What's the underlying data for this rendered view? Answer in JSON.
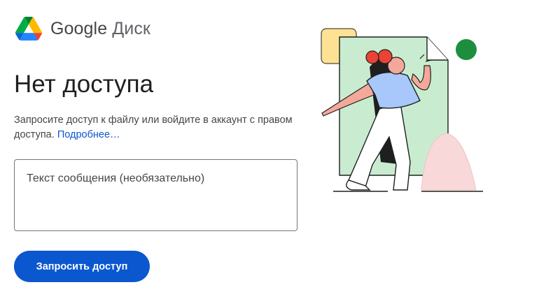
{
  "header": {
    "logo_icon": "google-drive-icon",
    "brand_google": "Google",
    "brand_product": "Диск"
  },
  "main": {
    "title": "Нет доступа",
    "description": "Запросите доступ к файлу или войдите в аккаунт с правом доступа.",
    "learn_more_link": "Подробнее…",
    "message_placeholder": "Текст сообщения (необязательно)",
    "request_button": "Запросить доступ"
  },
  "illustration": {
    "icon": "person-leaving-document-illustration"
  },
  "colors": {
    "accent_blue": "#0b57d0",
    "illustration_green": "#c9ecd0",
    "illustration_red": "#ea4335",
    "illustration_light_blue": "#a8c7fa",
    "illustration_yellow": "#fde293",
    "illustration_pink": "#f8d8d8"
  }
}
